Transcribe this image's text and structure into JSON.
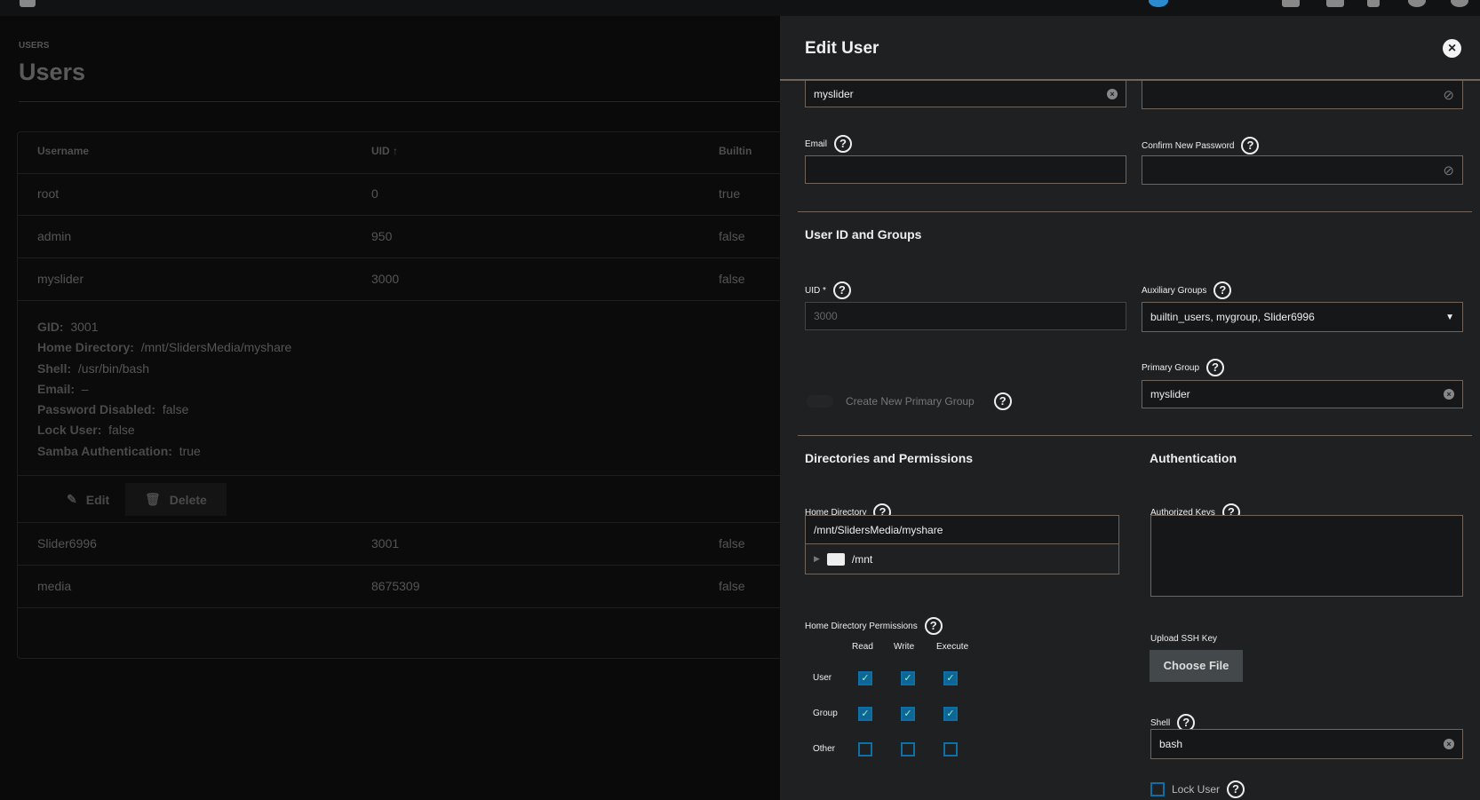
{
  "page": {
    "breadcrumb": "USERS",
    "title": "Users"
  },
  "table": {
    "headers": {
      "username": "Username",
      "uid": "UID",
      "builtin": "Builtin",
      "sort_icon": "↑"
    },
    "rows": [
      {
        "username": "root",
        "uid": "0",
        "builtin": "true"
      },
      {
        "username": "admin",
        "uid": "950",
        "builtin": "false"
      },
      {
        "username": "myslider",
        "uid": "3000",
        "builtin": "false"
      },
      {
        "username": "Slider6996",
        "uid": "3001",
        "builtin": "false"
      },
      {
        "username": "media",
        "uid": "8675309",
        "builtin": "false"
      }
    ],
    "details": [
      {
        "k": "GID:",
        "v": "3001"
      },
      {
        "k": "Home Directory:",
        "v": "/mnt/SlidersMedia/myshare"
      },
      {
        "k": "Shell:",
        "v": "/usr/bin/bash"
      },
      {
        "k": "Email:",
        "v": "–"
      },
      {
        "k": "Password Disabled:",
        "v": "false"
      },
      {
        "k": "Lock User:",
        "v": "false"
      },
      {
        "k": "Samba Authentication:",
        "v": "true"
      }
    ],
    "edit_label": "Edit",
    "delete_label": "Delete"
  },
  "panel": {
    "title": "Edit User",
    "username_value": "myslider",
    "email_label": "Email",
    "confirm_password_label": "Confirm New Password",
    "section_ids": "User ID and Groups",
    "uid_label": "UID *",
    "uid_value": "3000",
    "aux_groups_label": "Auxiliary Groups",
    "aux_groups_value": "builtin_users, mygroup, Slider6996",
    "primary_group_label": "Primary Group",
    "primary_group_value": "myslider",
    "create_group_label": "Create New Primary Group",
    "section_dirs": "Directories and Permissions",
    "section_auth": "Authentication",
    "home_dir_label": "Home Directory",
    "home_dir_value": "/mnt/SlidersMedia/myshare",
    "tree_node": "/mnt",
    "perm_label": "Home Directory Permissions",
    "perm_cols": [
      "Read",
      "Write",
      "Execute"
    ],
    "perm_rows": [
      {
        "name": "User",
        "checks": [
          true,
          true,
          true
        ]
      },
      {
        "name": "Group",
        "checks": [
          true,
          true,
          true
        ]
      },
      {
        "name": "Other",
        "checks": [
          false,
          false,
          false
        ]
      }
    ],
    "auth_keys_label": "Authorized Keys",
    "upload_label": "Upload SSH Key",
    "choose_file": "Choose File",
    "shell_label": "Shell",
    "shell_value": "bash",
    "lock_user_label": "Lock User"
  },
  "colors": {
    "accent": "#0d6694",
    "panel_bg": "#1e2022",
    "border": "#6f655c"
  }
}
